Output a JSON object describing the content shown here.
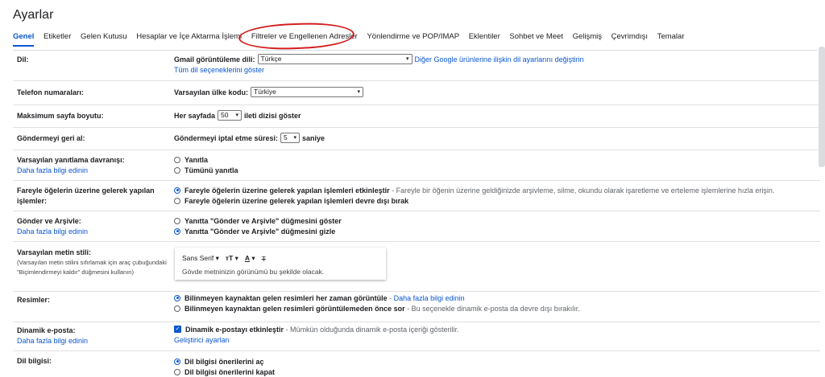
{
  "title": "Ayarlar",
  "tabs": [
    "Genel",
    "Etiketler",
    "Gelen Kutusu",
    "Hesaplar ve İçe Aktarma İşlemi",
    "Filtreler ve Engellenen Adresler",
    "Yönlendirme ve POP/IMAP",
    "Eklentiler",
    "Sohbet ve Meet",
    "Gelişmiş",
    "Çevrimdışı",
    "Temalar"
  ],
  "colors": {
    "accent": "#0b57d0",
    "annotation": "#d32020"
  },
  "language": {
    "label": "Dil:",
    "display_label": "Gmail görüntüleme dili:",
    "display_value": "Türkçe",
    "change_link": "Diğer Google ürünlerine ilişkin dil ayarlarını değiştirin",
    "all_options_link": "Tüm dil seçeneklerini göster"
  },
  "phone": {
    "label": "Telefon numaraları:",
    "country_label": "Varsayılan ülke kodu:",
    "country_value": "Türkiye"
  },
  "page_size": {
    "label": "Maksimum sayfa boyutu:",
    "prefix": "Her sayfada",
    "value": "50",
    "suffix": "ileti dizisi göster"
  },
  "undo_send": {
    "label": "Göndermeyi geri al:",
    "prefix": "Göndermeyi iptal etme süresi:",
    "value": "5",
    "suffix": "saniye"
  },
  "reply": {
    "label": "Varsayılan yanıtlama davranışı:",
    "learn_more": "Daha fazla bilgi edinin",
    "opt1": "Yanıtla",
    "opt2": "Tümünü yanıtla"
  },
  "hover": {
    "label_line1": "Fareyle öğelerin üzerine gelerek yapılan",
    "label_line2": "işlemler:",
    "opt1": "Fareyle öğelerin üzerine gelerek yapılan işlemleri etkinleştir",
    "opt1_desc": "- Fareyle bir öğenin üzerine geldiğinizde arşivleme, silme, okundu olarak işaretleme ve erteleme işlemlerine hızla erişin.",
    "opt2": "Fareyle öğelerin üzerine gelerek yapılan işlemleri devre dışı bırak"
  },
  "send_archive": {
    "label": "Gönder ve Arşivle:",
    "learn_more": "Daha fazla bilgi edinin",
    "opt1": "Yanıtta \"Gönder ve Arşivle\" düğmesini göster",
    "opt2": "Yanıtta \"Gönder ve Arşivle\" düğmesini gizle"
  },
  "text_style": {
    "label": "Varsayılan metin stili:",
    "hint_line1": "(Varsayılan metin stilini sıfırlamak için araç çubuğundaki",
    "hint_line2": "\"Biçimlendirmeyi kaldır\" düğmesini kullanın)",
    "font": "Sans Serif",
    "preview": "Gövde metninizin görünümü bu şekilde olacak."
  },
  "images": {
    "label": "Resimler:",
    "opt1": "Bilinmeyen kaynaktan gelen resimleri her zaman görüntüle",
    "opt1_link": "Daha fazla bilgi edinin",
    "opt2": "Bilinmeyen kaynaktan gelen resimleri görüntülemeden önce sor",
    "opt2_desc": "- Bu seçenekle dinamik e-posta da devre dışı bırakılır."
  },
  "dynamic": {
    "label": "Dinamik e-posta:",
    "learn_more": "Daha fazla bilgi edinin",
    "opt": "Dinamik e-postayı etkinleştir",
    "opt_desc": "- Mümkün olduğunda dinamik e-posta içeriği gösterilir.",
    "dev_link": "Geliştirici ayarları"
  },
  "grammar": {
    "label": "Dil bilgisi:",
    "opt1": "Dil bilgisi önerilerini aç",
    "opt2": "Dil bilgisi önerilerini kapat"
  }
}
